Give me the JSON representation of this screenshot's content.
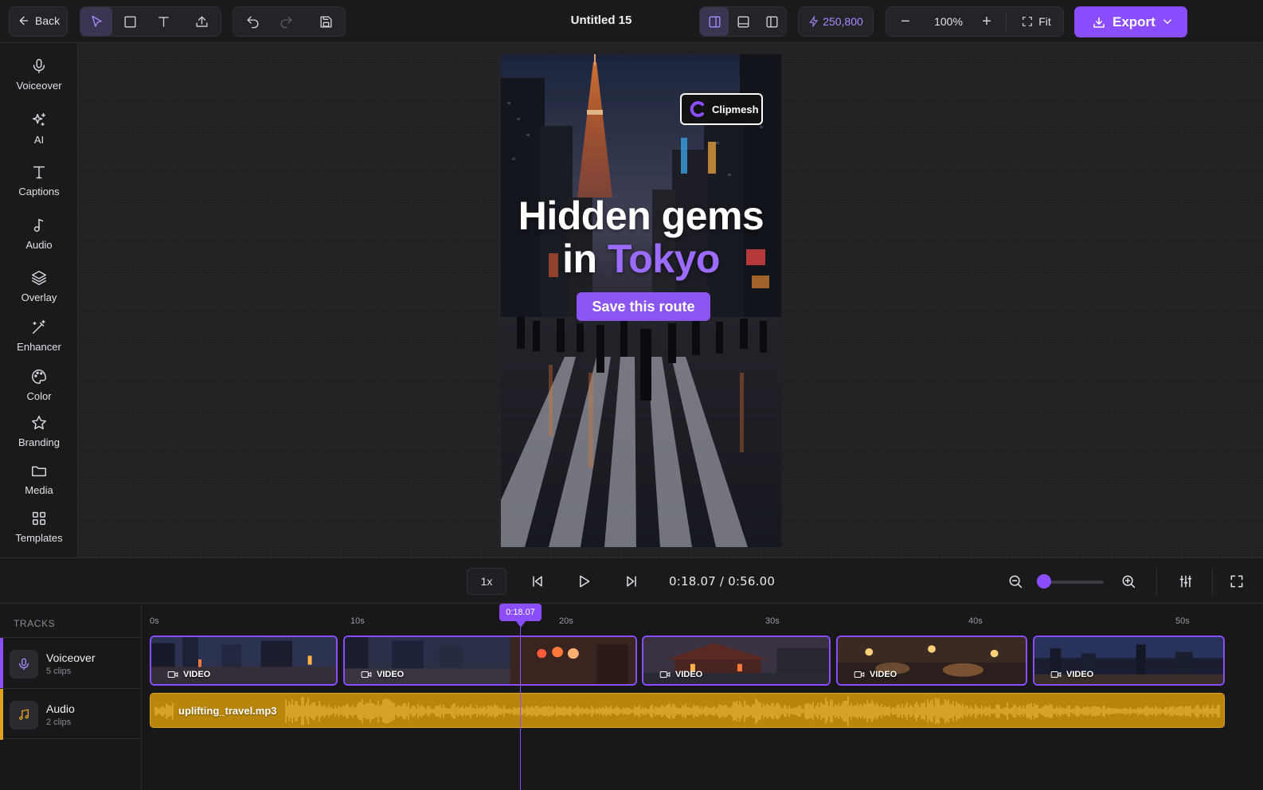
{
  "toolbar": {
    "back_label": "Back",
    "title": "Untitled 15",
    "credits": "250,800",
    "zoom": "100%",
    "fit_label": "Fit",
    "export_label": "Export"
  },
  "sidebar": {
    "items": [
      {
        "label": "Voiceover",
        "icon": "mic-icon"
      },
      {
        "label": "AI",
        "icon": "sparkles-icon"
      },
      {
        "label": "Captions",
        "icon": "text-icon"
      },
      {
        "label": "Audio",
        "icon": "music-note-icon"
      },
      {
        "label": "Overlay",
        "icon": "layers-icon"
      },
      {
        "label": "Enhancer",
        "icon": "magic-wand-icon"
      },
      {
        "label": "Color",
        "icon": "palette-icon"
      },
      {
        "label": "Branding",
        "icon": "star-icon"
      },
      {
        "label": "Media",
        "icon": "folder-icon"
      },
      {
        "label": "Templates",
        "icon": "grid-icon"
      }
    ]
  },
  "preview": {
    "brand": "Clipmesh",
    "headline_line1": "Hidden gems",
    "headline_in": "in ",
    "headline_accent": "Tokyo",
    "cta": "Save this route"
  },
  "player": {
    "speed": "1x",
    "current_time": "0:18.07",
    "separator": "/",
    "total_time": "0:56.00",
    "zoom_level": 0.0
  },
  "timeline": {
    "header": "TRACKS",
    "playhead_label": "0:18.07",
    "ruler": [
      "0s",
      "10s",
      "20s",
      "30s",
      "40s",
      "50s"
    ],
    "tracks": [
      {
        "name": "Voiceover",
        "sub": "5 clips",
        "color": "#8a4dff"
      },
      {
        "name": "Audio",
        "sub": "2 clips",
        "color": "#e0a320"
      }
    ],
    "clip_label": "VIDEO",
    "audio_file": "uplifting_travel.mp3"
  },
  "colors": {
    "accent": "#8a4dff",
    "audio": "#b8860b"
  }
}
